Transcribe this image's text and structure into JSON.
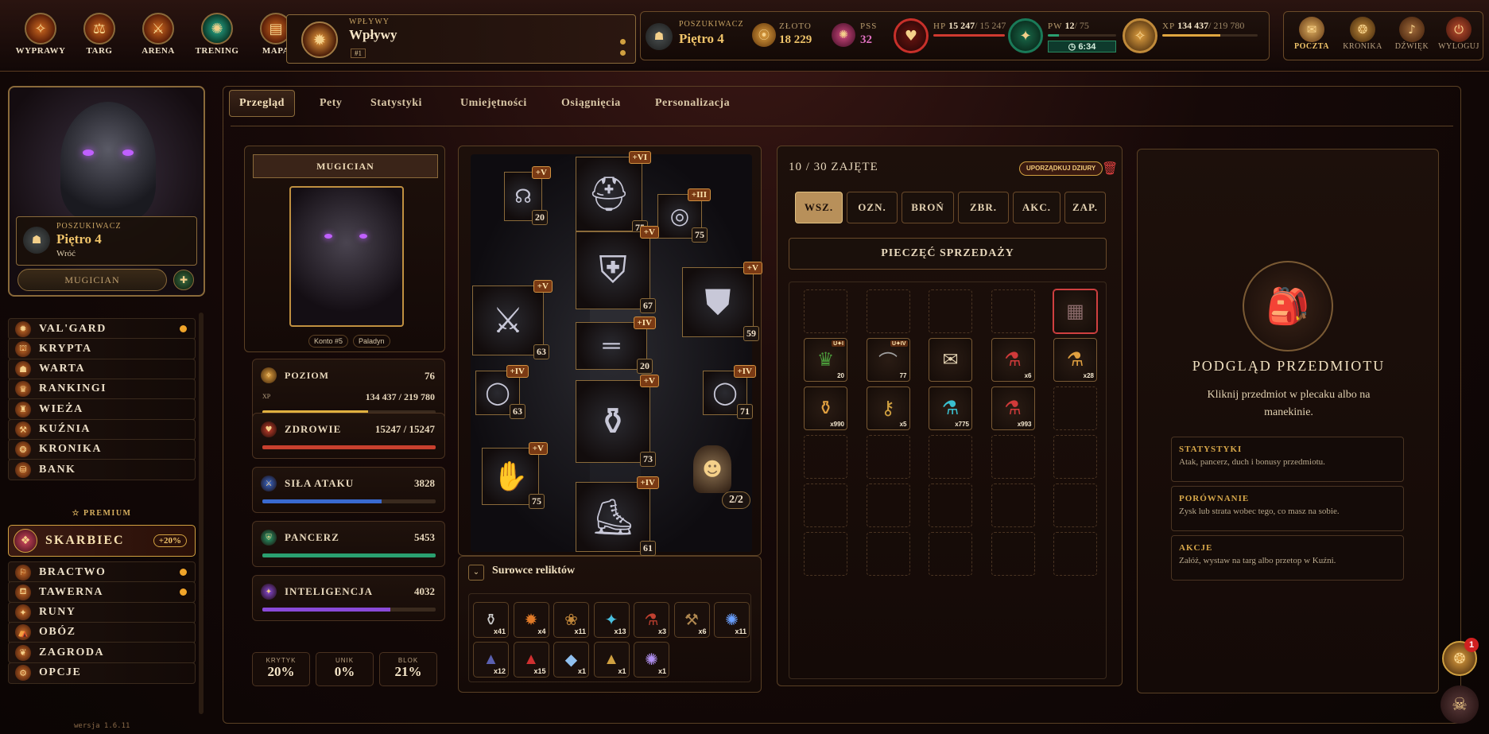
{
  "nav": [
    {
      "label": "WYPRAWY",
      "icon": "compass-icon"
    },
    {
      "label": "TARG",
      "icon": "market-icon"
    },
    {
      "label": "ARENA",
      "icon": "swords-icon"
    },
    {
      "label": "TRENING",
      "icon": "training-icon"
    },
    {
      "label": "MAPA",
      "icon": "map-icon"
    }
  ],
  "influence": {
    "small": "WPŁYWY",
    "title": "Wpływy",
    "rank": "#1"
  },
  "seeker": {
    "small": "POSZUKIWACZ",
    "floor": "Piętro 4"
  },
  "gold": {
    "label": "ZŁOTO",
    "value": "18 229"
  },
  "pss": {
    "label": "PSS",
    "value": "32"
  },
  "hp": {
    "label": "HP",
    "value": "15 247",
    "max": "/ 15 247",
    "fraction": 1.0,
    "color": "#d03a30"
  },
  "pw": {
    "label": "PW",
    "value": "12",
    "max": "/ 75",
    "timer": "6:34",
    "fraction": 0.16,
    "color": "#2aa070"
  },
  "xp": {
    "label": "XP",
    "value": "134 437",
    "max": "/ 219 780",
    "fraction": 0.61,
    "color": "#e0a640"
  },
  "topright": [
    {
      "label": "POCZTA",
      "icon": "mail-icon"
    },
    {
      "label": "KRONIKA",
      "icon": "chronicle-icon"
    },
    {
      "label": "DŹWIĘK",
      "icon": "sound-icon"
    },
    {
      "label": "WYLOGUJ",
      "icon": "logout-icon"
    }
  ],
  "profile": {
    "small": "POSZUKIWACZ",
    "floor": "Piętro 4",
    "back": "Wróć",
    "name": "MUGICIAN"
  },
  "sidebar": [
    {
      "label": "VAL'GARD",
      "dot": true
    },
    {
      "label": "KRYPTA",
      "dot": false
    },
    {
      "label": "WARTA",
      "dot": false
    },
    {
      "label": "RANKINGI",
      "dot": false
    },
    {
      "label": "WIEŻA",
      "dot": false
    },
    {
      "label": "KUŹNIA",
      "dot": false
    },
    {
      "label": "KRONIKA",
      "dot": false
    },
    {
      "label": "BANK",
      "dot": false
    }
  ],
  "premium": {
    "label": "PREMIUM",
    "item": "SKARBIEC",
    "badge": "+20%"
  },
  "sidebar2": [
    {
      "label": "BRACTWO",
      "dot": true
    },
    {
      "label": "TAWERNA",
      "dot": true
    },
    {
      "label": "RUNY",
      "dot": false
    },
    {
      "label": "OBÓZ",
      "dot": false
    },
    {
      "label": "ZAGRODA",
      "dot": false
    },
    {
      "label": "OPCJE",
      "dot": false
    }
  ],
  "version": "wersja 1.6.11",
  "tabs": [
    "Przegląd",
    "Pety",
    "Statystyki",
    "Umiejętności",
    "Osiągnięcia",
    "Personalizacja"
  ],
  "character": {
    "name": "MUGICIAN",
    "account": "Konto #5",
    "class": "Paladyn"
  },
  "stats": {
    "level": {
      "label": "POZIOM",
      "value": "76",
      "xp_label": "XP",
      "xp": "134 437 / 219 780",
      "fraction": 0.61
    },
    "health": {
      "label": "ZDROWIE",
      "value": "15247 / 15247",
      "fraction": 1.0,
      "color": "#c8402e"
    },
    "attack": {
      "label": "SIŁA ATAKU",
      "value": "3828",
      "fraction": 0.69,
      "color": "#3a6ad0"
    },
    "armor": {
      "label": "PANCERZ",
      "value": "5453",
      "fraction": 1.0,
      "color": "#2aa070"
    },
    "intel": {
      "label": "INTELIGENCJA",
      "value": "4032",
      "fraction": 0.74,
      "color": "#8a4ad8"
    }
  },
  "minis": [
    {
      "label": "KRYTYK",
      "value": "20%"
    },
    {
      "label": "UNIK",
      "value": "0%"
    },
    {
      "label": "BLOK",
      "value": "21%"
    }
  ],
  "equipment": [
    {
      "tier": "+V",
      "lvl": "20",
      "icon": "amulet-icon",
      "glyph": "☊"
    },
    {
      "tier": "+VI",
      "lvl": "75",
      "icon": "helmet-icon",
      "glyph": "⛑"
    },
    {
      "tier": "+III",
      "lvl": "75",
      "icon": "ring-icon",
      "glyph": "◎"
    },
    {
      "tier": "+V",
      "lvl": "67",
      "icon": "chest-armor-icon",
      "glyph": "⛨"
    },
    {
      "tier": "+V",
      "lvl": "63",
      "icon": "axe-icon",
      "glyph": "⚔"
    },
    {
      "tier": "+V",
      "lvl": "59",
      "icon": "shield-icon",
      "glyph": "⛊"
    },
    {
      "tier": "+IV",
      "lvl": "20",
      "icon": "belt-icon",
      "glyph": "═"
    },
    {
      "tier": "+IV",
      "lvl": "63",
      "icon": "ring-left-icon",
      "glyph": "◯"
    },
    {
      "tier": "+IV",
      "lvl": "71",
      "icon": "ring-right-icon",
      "glyph": "◯"
    },
    {
      "tier": "+V",
      "lvl": "73",
      "icon": "legs-icon",
      "glyph": "⚱"
    },
    {
      "tier": "+V",
      "lvl": "75",
      "icon": "gloves-icon",
      "glyph": "✋"
    },
    {
      "tier": "+IV",
      "lvl": "61",
      "icon": "boots-icon",
      "glyph": "⛸"
    }
  ],
  "pet_count": "2/2",
  "materials": {
    "title": "Surowce reliktów",
    "items": [
      {
        "c": "x41",
        "g": "⚱",
        "col": "#c9c9c9"
      },
      {
        "c": "x4",
        "g": "✹",
        "col": "#e07a28"
      },
      {
        "c": "x11",
        "g": "❀",
        "col": "#c0863a"
      },
      {
        "c": "x13",
        "g": "✦",
        "col": "#4ac0e0"
      },
      {
        "c": "x3",
        "g": "⚗",
        "col": "#c04030"
      },
      {
        "c": "x6",
        "g": "⚒",
        "col": "#b08850"
      },
      {
        "c": "x11",
        "g": "✺",
        "col": "#6aa0ff"
      },
      {
        "c": "x12",
        "g": "▲",
        "col": "#5a60b0"
      },
      {
        "c": "x15",
        "g": "▲",
        "col": "#d03030"
      },
      {
        "c": "x1",
        "g": "◆",
        "col": "#90c0f0"
      },
      {
        "c": "x1",
        "g": "▲",
        "col": "#d0a040"
      },
      {
        "c": "x1",
        "g": "✺",
        "col": "#b090f0"
      }
    ]
  },
  "inventory": {
    "occupied": "10 / 30 ZAJĘTE",
    "sort": "UPORZĄDKUJ DZIURY",
    "filters": [
      "WSZ.",
      "OZN.",
      "BROŃ",
      "ZBR.",
      "AKC.",
      "ZAP."
    ],
    "seal": "PIECZĘĆ SPRZEDAŻY",
    "items": [
      {
        "idx": 4,
        "g": "▦",
        "col": "#8a6a6a",
        "c": "",
        "tag": ""
      },
      {
        "idx": 5,
        "g": "♛",
        "col": "#4a9a3a",
        "c": "20",
        "tag": "U✦I"
      },
      {
        "idx": 6,
        "g": "⌒",
        "col": "#a0a0a0",
        "c": "77",
        "tag": "U✦IV"
      },
      {
        "idx": 7,
        "g": "✉",
        "col": "#e0d0b0",
        "c": "",
        "tag": ""
      },
      {
        "idx": 8,
        "g": "⚗",
        "col": "#d03a3a",
        "c": "x6",
        "tag": ""
      },
      {
        "idx": 9,
        "g": "⚗",
        "col": "#e0a040",
        "c": "x28",
        "tag": ""
      },
      {
        "idx": 10,
        "g": "⚱",
        "col": "#e0a040",
        "c": "x990",
        "tag": ""
      },
      {
        "idx": 11,
        "g": "⚷",
        "col": "#d0a040",
        "c": "x5",
        "tag": ""
      },
      {
        "idx": 12,
        "g": "⚗",
        "col": "#3ac0d0",
        "c": "x775",
        "tag": ""
      },
      {
        "idx": 13,
        "g": "⚗",
        "col": "#d03a3a",
        "c": "x993",
        "tag": ""
      }
    ]
  },
  "preview": {
    "title": "PODGLĄD PRZEDMIOTU",
    "desc": "Kliknij przedmiot w plecaku albo na manekinie.",
    "boxes": [
      {
        "h": "STATYSTYKI",
        "t": "Atak, pancerz, duch i bonusy przedmiotu."
      },
      {
        "h": "PORÓWNANIE",
        "t": "Zysk lub strata wobec tego, co masz na sobie."
      },
      {
        "h": "AKCJE",
        "t": "Załóż, wystaw na targ albo przetop w Kuźni."
      }
    ]
  },
  "notification_count": "1"
}
